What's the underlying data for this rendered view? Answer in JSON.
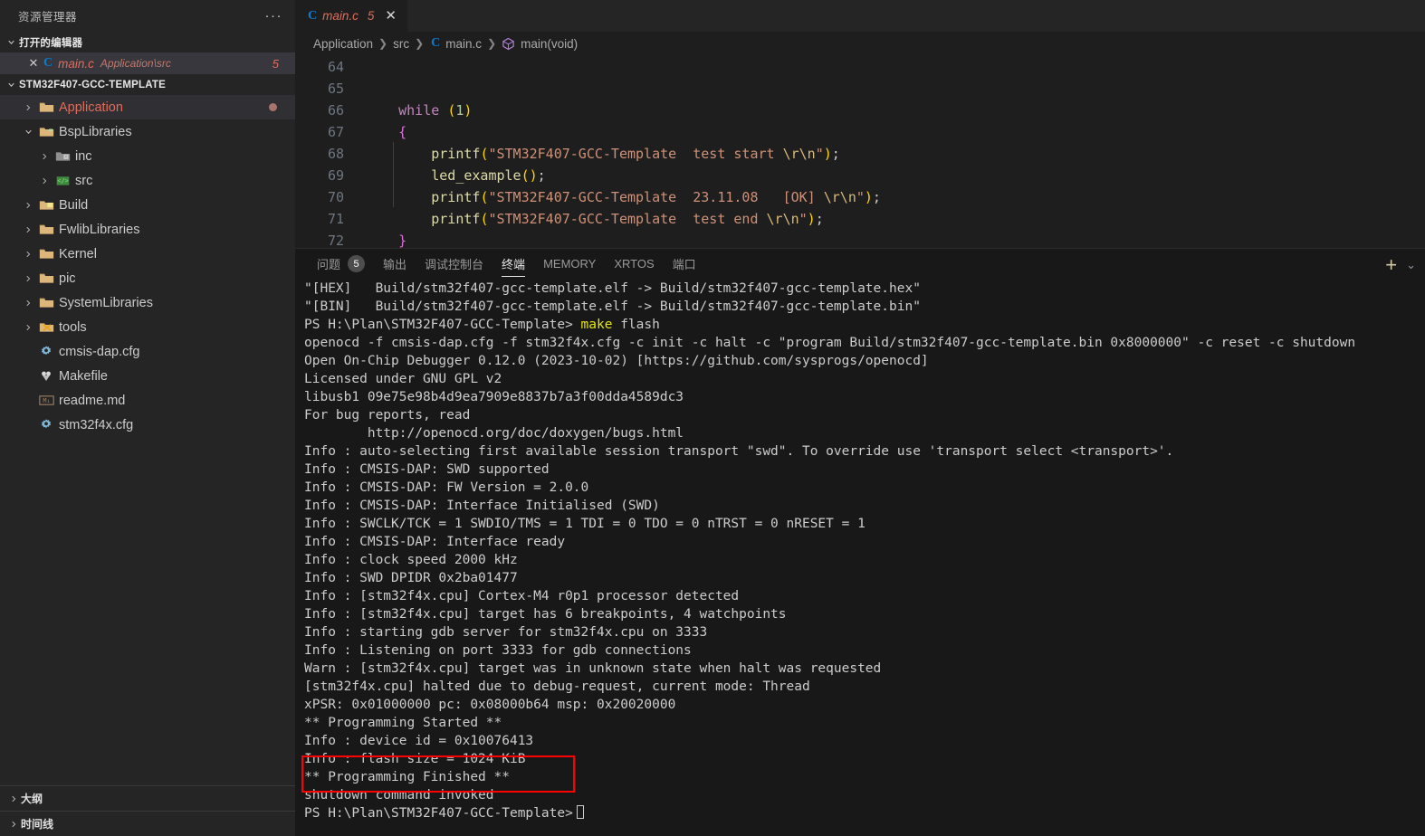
{
  "sidebar": {
    "title": "资源管理器",
    "more_label": "···",
    "open_editors": {
      "header": "打开的编辑器",
      "items": [
        {
          "close": "✕",
          "icon": "c-file-icon",
          "name": "main.c",
          "path": "Application\\src",
          "badge": "5"
        }
      ]
    },
    "project": {
      "header": "STM32F407-GCC-TEMPLATE",
      "items": [
        {
          "label": "Application",
          "icon": "folder-icon",
          "expandable": true,
          "selected": true,
          "modified": true
        },
        {
          "label": "BspLibraries",
          "icon": "folder-open-icon",
          "expandable": true,
          "expanded": true
        },
        {
          "label": "inc",
          "icon": "folder-inc-icon",
          "expandable": true,
          "depth": 2
        },
        {
          "label": "src",
          "icon": "folder-src-icon",
          "expandable": true,
          "depth": 2
        },
        {
          "label": "Build",
          "icon": "folder-build-icon",
          "expandable": true
        },
        {
          "label": "FwlibLibraries",
          "icon": "folder-icon",
          "expandable": true
        },
        {
          "label": "Kernel",
          "icon": "folder-icon",
          "expandable": true
        },
        {
          "label": "pic",
          "icon": "folder-icon",
          "expandable": true
        },
        {
          "label": "SystemLibraries",
          "icon": "folder-icon",
          "expandable": true
        },
        {
          "label": "tools",
          "icon": "folder-tools-icon",
          "expandable": true
        },
        {
          "label": "cmsis-dap.cfg",
          "icon": "gear-icon",
          "expandable": false
        },
        {
          "label": "Makefile",
          "icon": "makefile-icon",
          "expandable": false
        },
        {
          "label": "readme.md",
          "icon": "markdown-icon",
          "expandable": false
        },
        {
          "label": "stm32f4x.cfg",
          "icon": "gear-icon",
          "expandable": false
        }
      ]
    },
    "outline_label": "大纲",
    "timeline_label": "时间线"
  },
  "editor": {
    "tab": {
      "icon": "c-file-icon",
      "name": "main.c",
      "badge": "5",
      "close": "✕"
    },
    "breadcrumb": [
      {
        "label": "Application",
        "icon": null
      },
      {
        "label": "src",
        "icon": null
      },
      {
        "label": "main.c",
        "icon": "c-file-icon"
      },
      {
        "label": "main(void)",
        "icon": "symbol-method-icon"
      }
    ],
    "line_numbers": [
      "64",
      "65",
      "66",
      "67",
      "68",
      "69",
      "70",
      "71",
      "72"
    ],
    "code_lines": [
      "",
      "",
      "    while (1)",
      "    {",
      "        printf(\"STM32F407-GCC-Template  test start \\r\\n\");",
      "        led_example();",
      "        printf(\"STM32F407-GCC-Template  23.11.08   [OK] \\r\\n\");",
      "        printf(\"STM32F407-GCC-Template  test end \\r\\n\");",
      "    }"
    ]
  },
  "panel": {
    "tabs": [
      {
        "label": "问题",
        "count": "5",
        "active": false
      },
      {
        "label": "输出",
        "count": null,
        "active": false
      },
      {
        "label": "调试控制台",
        "count": null,
        "active": false
      },
      {
        "label": "终端",
        "count": null,
        "active": true
      },
      {
        "label": "MEMORY",
        "count": null,
        "active": false
      },
      {
        "label": "XRTOS",
        "count": null,
        "active": false
      },
      {
        "label": "端口",
        "count": null,
        "active": false
      }
    ],
    "actions": {
      "new_terminal": "+",
      "chevron": "⌄"
    }
  },
  "terminal": {
    "lines": [
      "\"[HEX]   Build/stm32f407-gcc-template.elf -> Build/stm32f407-gcc-template.hex\"",
      "\"[BIN]   Build/stm32f407-gcc-template.elf -> Build/stm32f407-gcc-template.bin\"",
      "PS H:\\Plan\\STM32F407-GCC-Template> make flash",
      "openocd -f cmsis-dap.cfg -f stm32f4x.cfg -c init -c halt -c \"program Build/stm32f407-gcc-template.bin 0x8000000\" -c reset -c shutdown",
      "Open On-Chip Debugger 0.12.0 (2023-10-02) [https://github.com/sysprogs/openocd]",
      "Licensed under GNU GPL v2",
      "libusb1 09e75e98b4d9ea7909e8837b7a3f00dda4589dc3",
      "For bug reports, read",
      "        http://openocd.org/doc/doxygen/bugs.html",
      "Info : auto-selecting first available session transport \"swd\". To override use 'transport select <transport>'.",
      "Info : CMSIS-DAP: SWD supported",
      "Info : CMSIS-DAP: FW Version = 2.0.0",
      "Info : CMSIS-DAP: Interface Initialised (SWD)",
      "Info : SWCLK/TCK = 1 SWDIO/TMS = 1 TDI = 0 TDO = 0 nTRST = 0 nRESET = 1",
      "Info : CMSIS-DAP: Interface ready",
      "Info : clock speed 2000 kHz",
      "Info : SWD DPIDR 0x2ba01477",
      "Info : [stm32f4x.cpu] Cortex-M4 r0p1 processor detected",
      "Info : [stm32f4x.cpu] target has 6 breakpoints, 4 watchpoints",
      "Info : starting gdb server for stm32f4x.cpu on 3333",
      "Info : Listening on port 3333 for gdb connections",
      "Warn : [stm32f4x.cpu] target was in unknown state when halt was requested",
      "[stm32f4x.cpu] halted due to debug-request, current mode: Thread",
      "xPSR: 0x01000000 pc: 0x08000b64 msp: 0x20020000",
      "** Programming Started **",
      "Info : device id = 0x10076413",
      "Info : flash size = 1024 KiB",
      "** Programming Finished **",
      "shutdown command invoked",
      "PS H:\\Plan\\STM32F407-GCC-Template>"
    ],
    "prompt_line_index": 2,
    "prompt_command": "make",
    "prompt_command_args": " flash",
    "highlight_box": {
      "color": "#ff0000",
      "from_line": 27,
      "to_line": 28
    }
  },
  "colors": {
    "sidebar_bg": "#252526",
    "editor_bg": "#1e1e1e",
    "panel_bg": "#181818",
    "accent_red": "#e06c5a",
    "highlight_red": "#ff0000",
    "string_orange": "#ce9178",
    "keyword_purple": "#c586c0",
    "function_yellow": "#dcdcaa"
  }
}
